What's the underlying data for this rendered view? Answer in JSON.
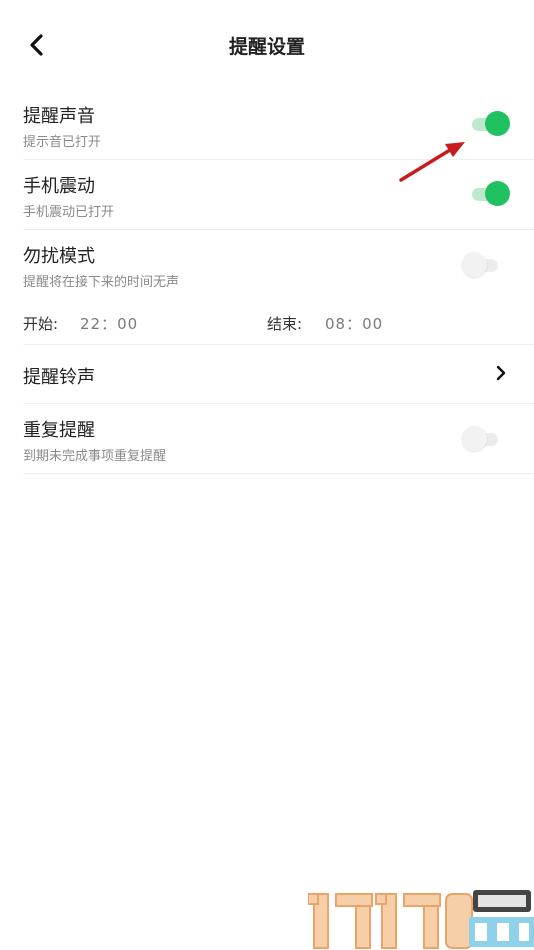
{
  "header": {
    "title": "提醒设置"
  },
  "settings": {
    "sound": {
      "title": "提醒声音",
      "subtitle": "提示音已打开",
      "enabled": true
    },
    "vibrate": {
      "title": "手机震动",
      "subtitle": "手机震动已打开",
      "enabled": true
    },
    "dnd": {
      "title": "勿扰模式",
      "subtitle": "提醒将在接下来的时间无声",
      "enabled": false,
      "start_label": "开始:",
      "start_time": "22：00",
      "end_label": "结束:",
      "end_time": "08：00"
    },
    "ringtone": {
      "title": "提醒铃声"
    },
    "repeat": {
      "title": "重复提醒",
      "subtitle": "到期未完成事项重复提醒",
      "enabled": false
    }
  },
  "colors": {
    "accent": "#1fc160",
    "annotation_arrow": "#d42020"
  },
  "icons": {
    "back": "back-arrow-icon",
    "chevron": "chevron-right-icon"
  }
}
